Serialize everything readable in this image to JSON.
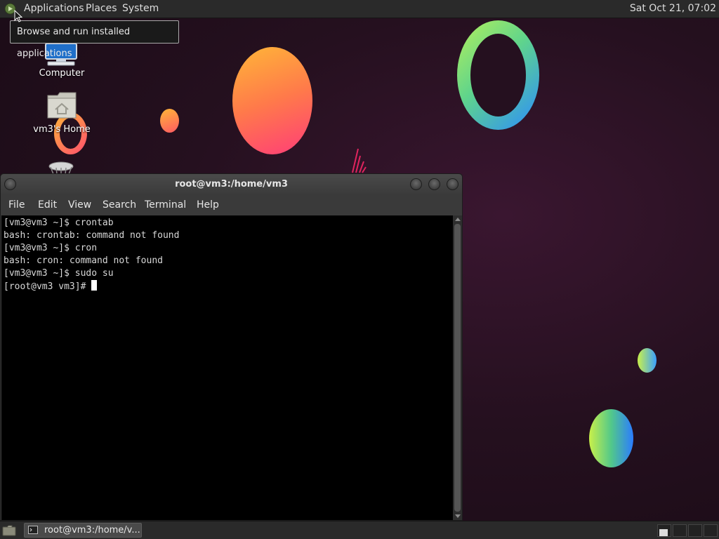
{
  "top_panel": {
    "menus": [
      "Applications",
      "Places",
      "System"
    ],
    "clock": "Sat Oct 21, 07:02"
  },
  "tooltip": "Browse and run installed applications",
  "desktop_icons": {
    "computer": "Computer",
    "home": "vm3's Home",
    "trash": "Trash"
  },
  "terminal": {
    "title": "root@vm3:/home/vm3",
    "menus": [
      "File",
      "Edit",
      "View",
      "Search",
      "Terminal",
      "Help"
    ],
    "lines": [
      "[vm3@vm3 ~]$ crontab",
      "bash: crontab: command not found",
      "[vm3@vm3 ~]$ cron",
      "bash: cron: command not found",
      "[vm3@vm3 ~]$ sudo su",
      "[root@vm3 vm3]# "
    ]
  },
  "taskbar": {
    "terminal_item": "root@vm3:/home/v..."
  },
  "colors": {
    "panel": "#2a2a2a",
    "terminal_bg": "#000000",
    "terminal_fg": "#d8d8d8"
  },
  "icons": [
    "mate-logo-icon",
    "computer-icon",
    "home-folder-icon",
    "trash-icon",
    "terminal-icon",
    "show-desktop-icon"
  ]
}
